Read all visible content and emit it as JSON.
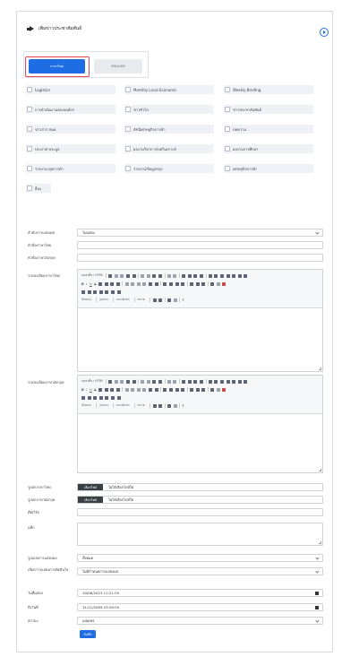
{
  "header": {
    "title": "เพิ่มข่าวประชาสัมพันธ์"
  },
  "tabs": [
    {
      "label": "ภาษาไทย",
      "active": true
    },
    {
      "label": "ENGLISH",
      "active": false
    }
  ],
  "categories": [
    "Logistics",
    "Monthly Local Economic",
    "Weekly Briefing",
    "การดำเนินงานขององค์กร",
    "ข่าวทั่วไป",
    "ข่าวประชาสัมพันธ์",
    "ข่าวสาร สนค.",
    "ดัชนีเศรษฐกิจการค้า",
    "บทความ",
    "ประกาศ-ประมูล",
    "ผลงานวิชาการ/บทวิเคราะห์",
    "ผลงานการศึกษา",
    "รายงาน-ดุลการค้า",
    "รายงาน/ข้อมูลสรุป",
    "เศรษฐกิจการค้า",
    "อื่นๆ"
  ],
  "form": {
    "display_label": "ลำดับการแสดงผล",
    "display_value": "ไม่แสดง",
    "title_th_label": "หัวข้อภาษาไทย",
    "title_en_label": "หัวข้อภาษาอังกฤษ",
    "detail_th_label": "รายละเอียดภาษาไทย",
    "detail_en_label": "รายละเอียดภาษาอังกฤษ",
    "editor": {
      "source": "แหล่งที่มา HTML",
      "format": "ลักษณะ",
      "paragraph": "รูปแบบ",
      "font": "แบบอักษร",
      "size": "ขนาด",
      "bold": "B",
      "italic": "I",
      "underline": "U",
      "strike": "S",
      "help": "?"
    },
    "image_th_label": "รูปปกภาษาไทย",
    "image_en_label": "รูปปกภาษาอังกฤษ",
    "choose_file": "เลือกไฟล์",
    "no_file": "ไม่ได้เลือกไฟล์ใด",
    "keyword_label": "คีย์เวิร์ด",
    "tag_label": "แท็ก",
    "status_display_label": "รูปแบบการแสดงผล",
    "status_display_value": "ทั้งหมด",
    "expire_label": "เลือกการแสดงการตัดสินใจ",
    "expire_value": "ไม่มีกำหนดการแสดงผล",
    "start_label": "วันที่แสดง",
    "start_value": "10/06/2023 11:21:59",
    "end_label": "ถึงวันที่",
    "end_value": "31/12/2099 23:59:59",
    "status_label": "สถานะ",
    "status_value": "เผยแพร่",
    "save_label": "บันทึก"
  }
}
